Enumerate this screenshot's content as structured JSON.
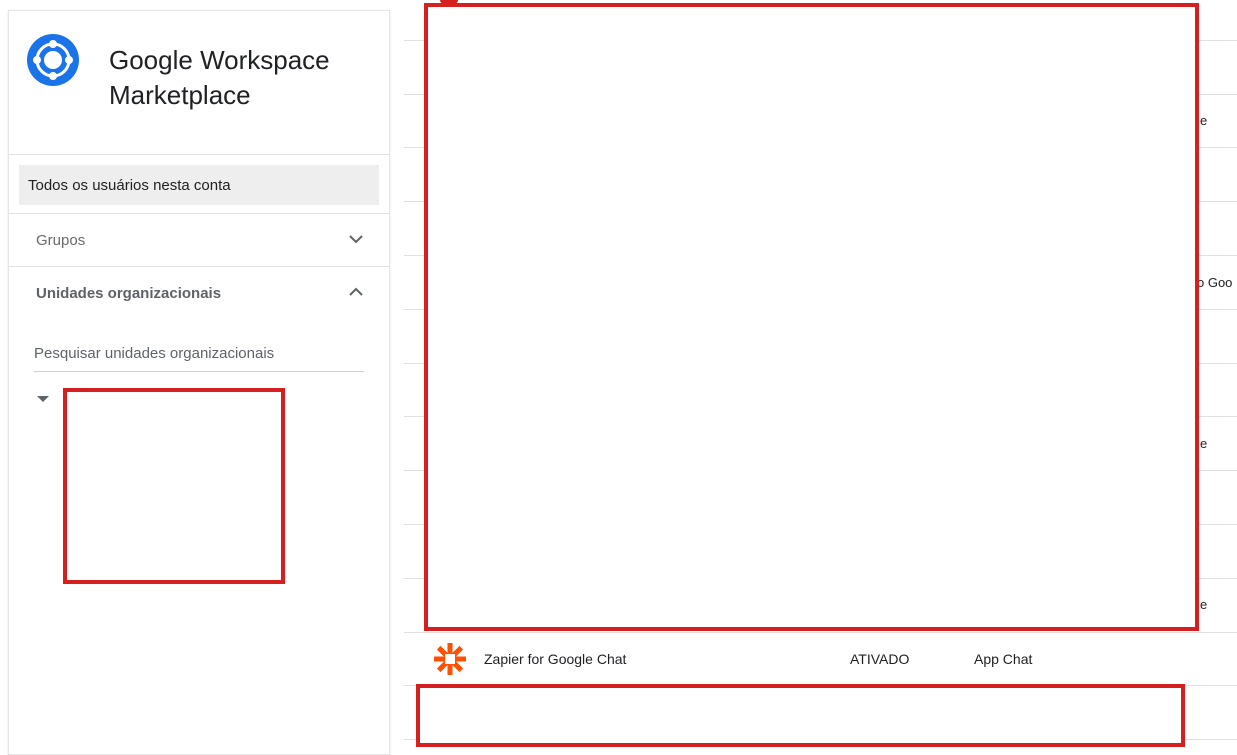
{
  "sidebar": {
    "title": "Google Workspace Marketplace",
    "logo_icon": "workspace-marketplace-logo-icon",
    "all_users_label": "Todos os usuários nesta conta",
    "groups_label": "Grupos",
    "org_units_label": "Unidades organizacionais",
    "org_units_search_placeholder": "Pesquisar unidades organizacionais"
  },
  "list": {
    "truncated_labels": [
      "e",
      "o Goo",
      "e",
      "e"
    ],
    "apps": [
      {
        "name": "Zapier for Google Chat",
        "status": "ATIVADO",
        "type": "App Chat",
        "icon": "zapier-asterisk-icon",
        "icon_color": "#FF4F00"
      }
    ]
  },
  "colors": {
    "redaction": "#D62020",
    "logo_blue": "#1A73E8"
  }
}
